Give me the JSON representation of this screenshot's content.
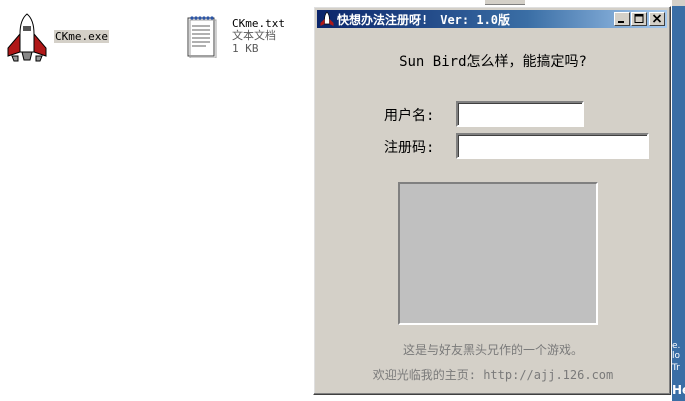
{
  "desktop": {
    "files": [
      {
        "name": "CKme.exe",
        "icon": "shuttle-icon"
      },
      {
        "name": "CKme.txt",
        "type": "文本文档",
        "size": "1 KB",
        "icon": "notepad-icon"
      }
    ]
  },
  "window": {
    "title": "快想办法注册呀!",
    "version": "Ver: 1.0版",
    "question": "Sun Bird怎么样，能搞定吗?",
    "username_label": "用户名:",
    "username_value": "",
    "regcode_label": "注册码:",
    "regcode_value": "",
    "footer_line1": "这是与好友黑头兄作的一个游戏。",
    "footer_line2": "欢迎光临我的主页: http://ajj.126.com"
  },
  "background_fragments": [
    "e.",
    "lo",
    "Tr",
    "He"
  ],
  "colors": {
    "titlebar_start": "#0a246a",
    "titlebar_end": "#a6caf0",
    "window_face": "#d4d0c8",
    "desktop_right": "#3a6ea5"
  }
}
